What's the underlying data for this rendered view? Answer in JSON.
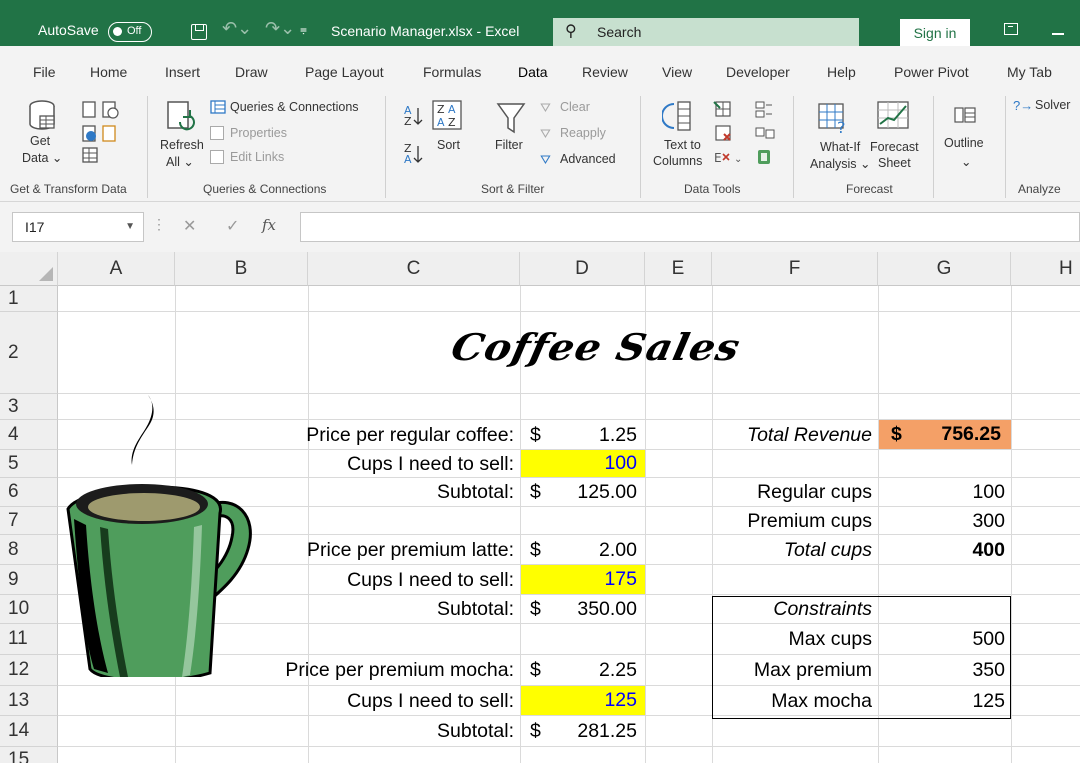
{
  "titlebar": {
    "autosave_label": "AutoSave",
    "autosave_state": "Off",
    "filename": "Scenario Manager.xlsx  -  Excel",
    "search_placeholder": "Search",
    "signin_label": "Sign in",
    "accent": "#217346"
  },
  "tabs": [
    {
      "label": "File"
    },
    {
      "label": "Home"
    },
    {
      "label": "Insert"
    },
    {
      "label": "Draw"
    },
    {
      "label": "Page Layout"
    },
    {
      "label": "Formulas"
    },
    {
      "label": "Data"
    },
    {
      "label": "Review"
    },
    {
      "label": "View"
    },
    {
      "label": "Developer"
    },
    {
      "label": "Help"
    },
    {
      "label": "Power Pivot"
    },
    {
      "label": "My Tab"
    }
  ],
  "active_tab": "Data",
  "ribbon": {
    "get_data_line1": "Get",
    "get_data_line2": "Data",
    "refresh_line1": "Refresh",
    "refresh_line2": "All",
    "queries_connections": "Queries & Connections",
    "properties": "Properties",
    "edit_links": "Edit Links",
    "sort": "Sort",
    "filter": "Filter",
    "clear": "Clear",
    "reapply": "Reapply",
    "advanced": "Advanced",
    "text_to_columns_line1": "Text to",
    "text_to_columns_line2": "Columns",
    "what_if_line1": "What-If",
    "what_if_line2": "Analysis",
    "forecast_sheet_line1": "Forecast",
    "forecast_sheet_line2": "Sheet",
    "outline": "Outline",
    "solver": "Solver",
    "groups": {
      "get_transform": "Get & Transform Data",
      "queries": "Queries & Connections",
      "sort_filter": "Sort & Filter",
      "data_tools": "Data Tools",
      "forecast": "Forecast",
      "analyze": "Analyze"
    }
  },
  "formula_bar": {
    "name_box": "I17",
    "fx": "fx",
    "formula": ""
  },
  "sheet": {
    "columns": [
      "A",
      "B",
      "C",
      "D",
      "E",
      "F",
      "G",
      "H"
    ],
    "rows": [
      "1",
      "2",
      "3",
      "4",
      "5",
      "6",
      "7",
      "8",
      "9",
      "10",
      "11",
      "12",
      "13",
      "14",
      "15"
    ],
    "title": "Coffee Sales",
    "c4": "Price per regular coffee:",
    "c5": "Cups I need to sell:",
    "c6": "Subtotal:",
    "c8": "Price per premium latte:",
    "c9": "Cups I need to sell:",
    "c10": "Subtotal:",
    "c12": "Price per premium mocha:",
    "c13": "Cups I need to sell:",
    "c14": "Subtotal:",
    "d4_sym": "$",
    "d4_val": "1.25",
    "d5": "100",
    "d6_sym": "$",
    "d6_val": "125.00",
    "d8_sym": "$",
    "d8_val": "2.00",
    "d9": "175",
    "d10_sym": "$",
    "d10_val": "350.00",
    "d12_sym": "$",
    "d12_val": "2.25",
    "d13": "125",
    "d14_sym": "$",
    "d14_val": "281.25",
    "f4": "Total Revenue",
    "g4_sym": "$",
    "g4_val": "756.25",
    "f6": "Regular cups",
    "g6": "100",
    "f7": "Premium cups",
    "g7": "300",
    "f8": "Total cups",
    "g8": "400",
    "f10": "Constraints",
    "f11": "Max cups",
    "g11": "500",
    "f12": "Max premium",
    "g12": "350",
    "f13": "Max mocha",
    "g13": "125",
    "input_highlight": "#ffff00",
    "revenue_highlight": "#f4a067"
  }
}
